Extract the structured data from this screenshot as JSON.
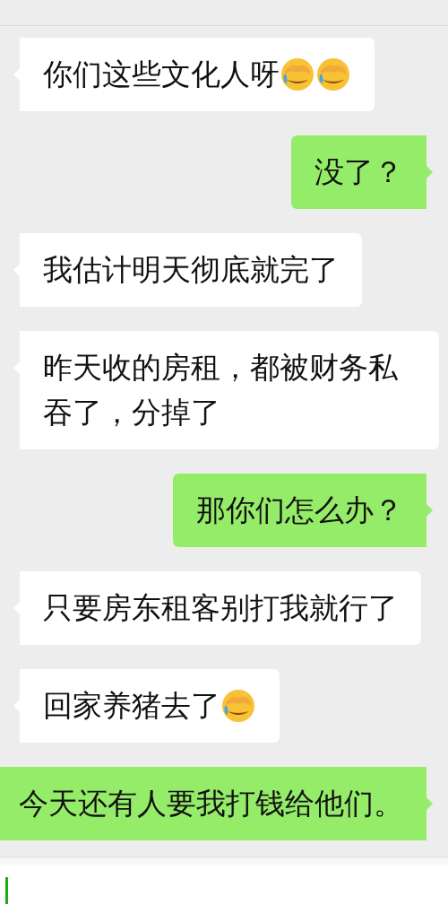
{
  "messages": [
    {
      "sent": false,
      "parts": [
        {
          "kind": "text",
          "text": "你们这些文化人呀"
        },
        {
          "kind": "emoji"
        },
        {
          "kind": "emoji"
        }
      ]
    },
    {
      "sent": true,
      "parts": [
        {
          "kind": "text",
          "text": "没了？"
        }
      ]
    },
    {
      "sent": false,
      "parts": [
        {
          "kind": "text",
          "text": "我估计明天彻底就完了"
        }
      ]
    },
    {
      "sent": false,
      "parts": [
        {
          "kind": "text",
          "text": "昨天收的房租，都被财务私吞了，分掉了"
        }
      ]
    },
    {
      "sent": true,
      "parts": [
        {
          "kind": "text",
          "text": "那你们怎么办？"
        }
      ]
    },
    {
      "sent": false,
      "parts": [
        {
          "kind": "text",
          "text": "只要房东租客别打我就行了"
        }
      ]
    },
    {
      "sent": false,
      "parts": [
        {
          "kind": "text",
          "text": "回家养猪去了"
        },
        {
          "kind": "emoji"
        }
      ]
    },
    {
      "sent": true,
      "parts": [
        {
          "kind": "text",
          "text": "今天还有人要我打钱给他们。"
        }
      ]
    }
  ],
  "input": {
    "focused": true
  }
}
